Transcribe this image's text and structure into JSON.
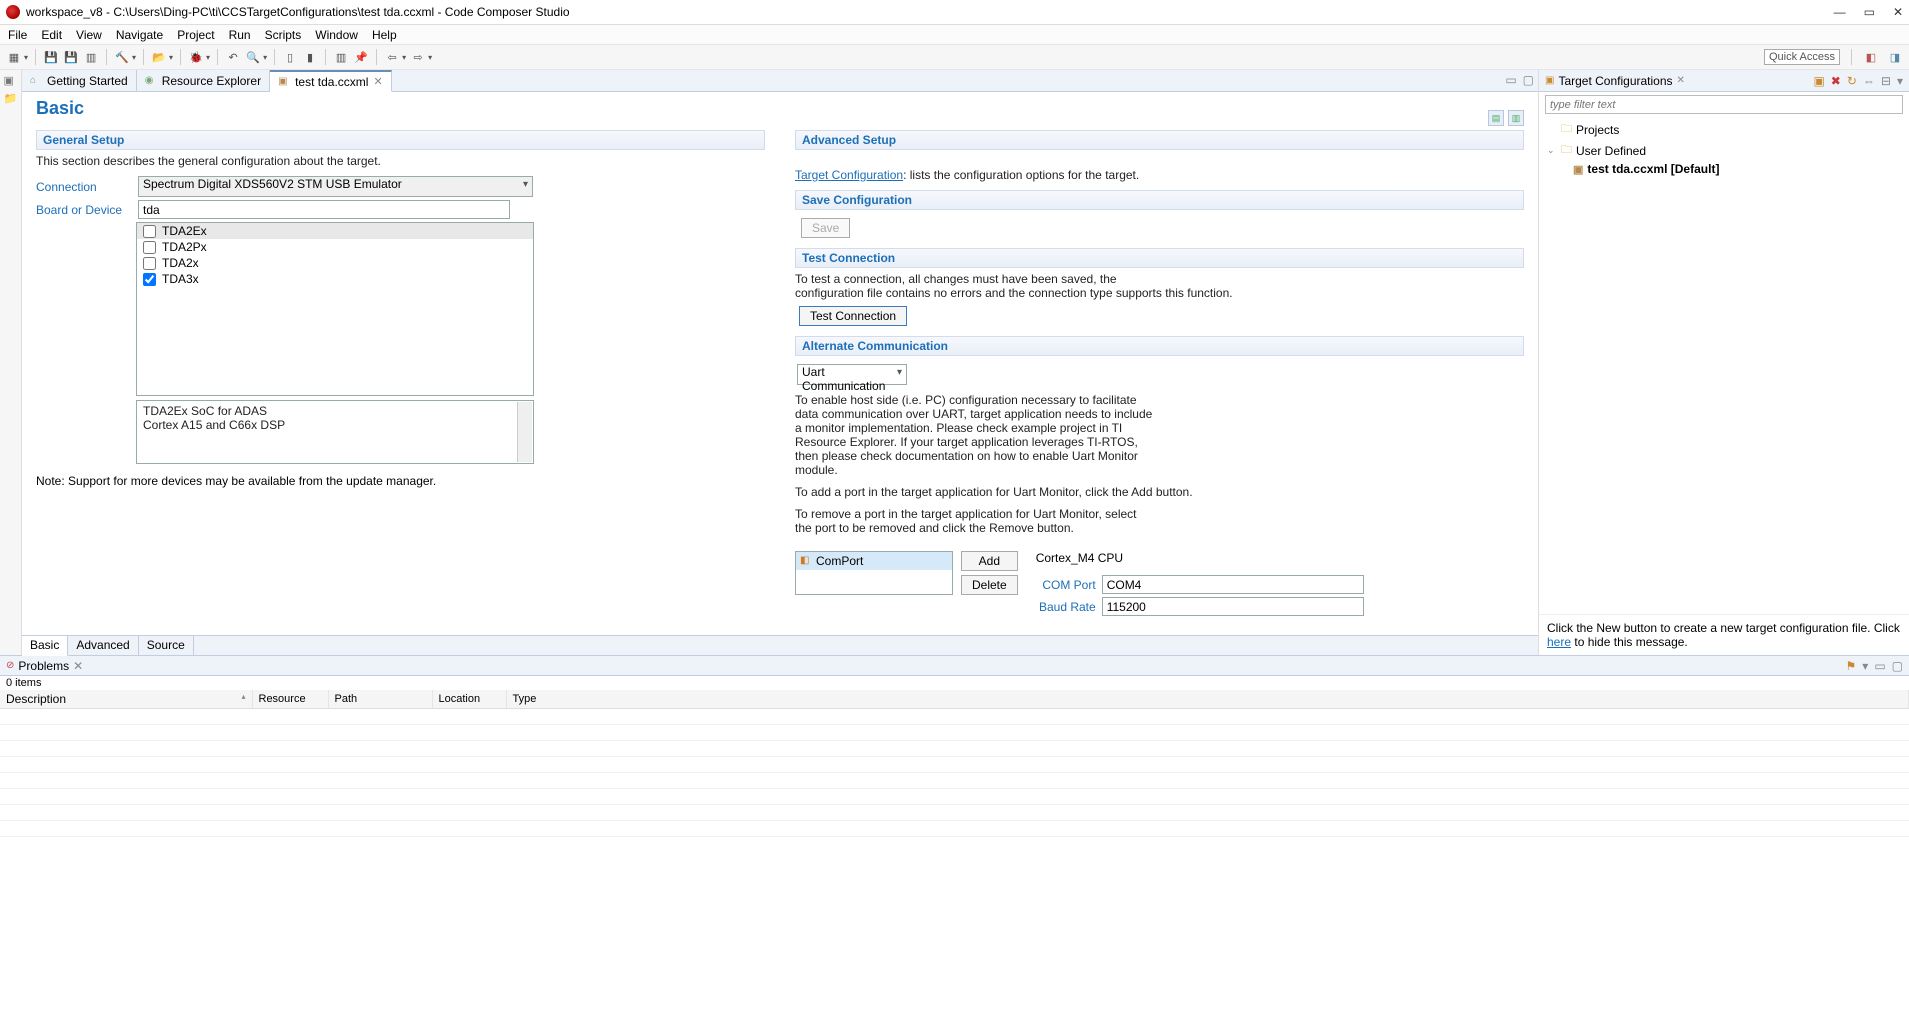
{
  "window": {
    "title": "workspace_v8 - C:\\Users\\Ding-PC\\ti\\CCSTargetConfigurations\\test tda.ccxml - Code Composer Studio"
  },
  "menu": {
    "items": [
      "File",
      "Edit",
      "View",
      "Navigate",
      "Project",
      "Run",
      "Scripts",
      "Window",
      "Help"
    ]
  },
  "toolbar": {
    "quick_access": "Quick Access"
  },
  "editor_tabs": [
    {
      "label": "Getting Started",
      "icon_color": "green",
      "closable": false
    },
    {
      "label": "Resource Explorer",
      "icon_color": "green",
      "closable": false
    },
    {
      "label": "test tda.ccxml",
      "icon_color": "brown",
      "closable": true,
      "active": true
    }
  ],
  "basic": {
    "title": "Basic",
    "general_setup": {
      "head": "General Setup",
      "desc": "This section describes the general configuration about the target.",
      "connection_label": "Connection",
      "connection_value": "Spectrum Digital XDS560V2 STM USB Emulator",
      "board_label": "Board or Device",
      "board_filter": "tda",
      "devices": [
        {
          "name": "TDA2Ex",
          "checked": false,
          "highlight": true
        },
        {
          "name": "TDA2Px",
          "checked": false
        },
        {
          "name": "TDA2x",
          "checked": false
        },
        {
          "name": "TDA3x",
          "checked": true
        }
      ],
      "desc_box_line1": "TDA2Ex SoC for ADAS",
      "desc_box_line2": "Cortex A15 and C66x DSP",
      "note": "Note: Support for more devices may be available from the update manager."
    },
    "advanced_setup": {
      "head": "Advanced Setup",
      "link": "Target Configuration",
      "link_tail": ": lists the configuration options for the target."
    },
    "save_cfg": {
      "head": "Save Configuration",
      "save_btn": "Save"
    },
    "test_conn": {
      "head": "Test Connection",
      "desc1": "To test a connection, all changes must have been saved, the",
      "desc2": "configuration file contains no errors and the connection type supports this function.",
      "btn": "Test Connection"
    },
    "alt_comm": {
      "head": "Alternate Communication",
      "select": "Uart Communication",
      "p1": "To enable host side (i.e. PC) configuration necessary to facilitate data communication over UART, target application needs to include a monitor implementation. Please check example project in TI Resource Explorer. If your target application leverages TI-RTOS, then please check documentation on how to enable Uart Monitor module.",
      "p2": "To add a port in the target application for Uart Monitor, click the Add button.",
      "p3": "To remove a port in the target application for Uart Monitor, select the port to be removed and click the Remove button.",
      "list_item": "ComPort",
      "add_btn": "Add",
      "del_btn": "Delete",
      "cpu_label": "Cortex_M4 CPU",
      "com_label": "COM Port",
      "com_value": "COM4",
      "baud_label": "Baud Rate",
      "baud_value": "115200"
    },
    "bottom_tabs": [
      "Basic",
      "Advanced",
      "Source"
    ]
  },
  "target_cfg": {
    "title": "Target Configurations",
    "filter_placeholder": "type filter text",
    "tree": {
      "projects": "Projects",
      "user_defined": "User Defined",
      "file": "test tda.ccxml [Default]"
    },
    "footer_pre": "Click the New button to create a new target configuration file. Click ",
    "footer_link": "here",
    "footer_post": " to hide this message."
  },
  "problems": {
    "title": "Problems",
    "count": "0 items",
    "cols": [
      "Description",
      "Resource",
      "Path",
      "Location",
      "Type"
    ]
  }
}
